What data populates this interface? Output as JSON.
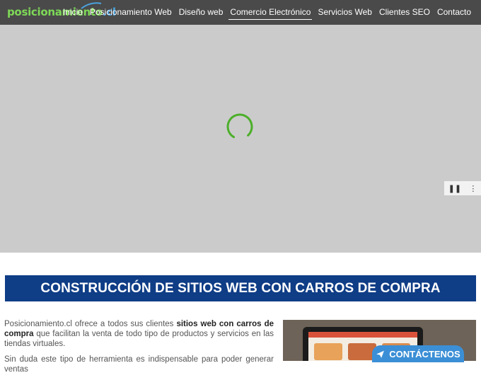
{
  "header": {
    "logo": {
      "main": "posicionamiento",
      "tld": ".cl"
    },
    "menu": [
      {
        "label": "Inicio",
        "active": false
      },
      {
        "label": "Posicionamiento Web",
        "active": false
      },
      {
        "label": "Diseño web",
        "active": false
      },
      {
        "label": "Comercio Electrónico",
        "active": true
      },
      {
        "label": "Servicios Web",
        "active": false
      },
      {
        "label": "Clientes SEO",
        "active": false
      },
      {
        "label": "Contacto",
        "active": false
      }
    ]
  },
  "hero": {
    "state": "loading",
    "controls": {
      "pause": "❚❚",
      "more": "⋮"
    }
  },
  "section": {
    "title": "CONSTRUCCIÓN DE SITIOS WEB CON CARROS DE COMPRA",
    "para1_a": "Posicionamiento.cl ofrece a todos sus clientes ",
    "para1_b": "sitios web con carros de compra",
    "para1_c": " que facilitan la venta de todo tipo de productos y servicios en las tiendas virtuales.",
    "para2": "Sin duda este tipo de herramienta es indispensable para poder generar ventas"
  },
  "cta": {
    "label": "CONTÁCTENOS"
  },
  "colors": {
    "nav_bg": "#4a4a4a",
    "hero_bg": "#cbcbcb",
    "title_bg": "#0f3d86",
    "accent_green": "#4caf2a",
    "cta_blue": "#3b8fd6"
  }
}
